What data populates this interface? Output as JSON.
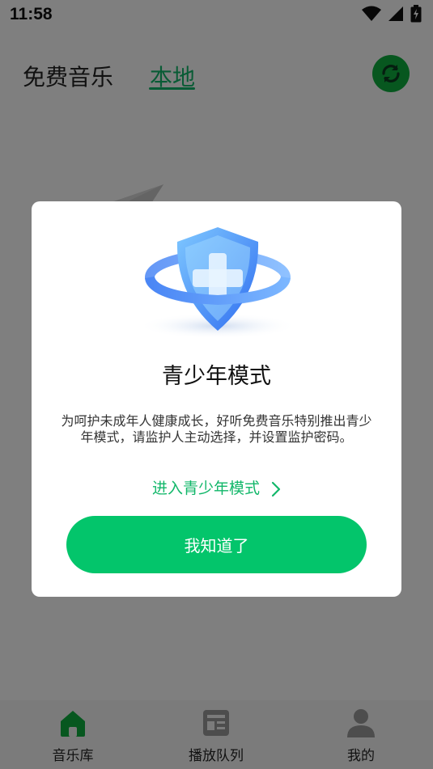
{
  "status_bar": {
    "time": "11:58",
    "icons": [
      "wifi-icon",
      "signal-icon",
      "battery-charging-icon"
    ]
  },
  "header": {
    "tabs": [
      {
        "label": "免费音乐",
        "active": false
      },
      {
        "label": "本地",
        "active": true
      }
    ],
    "refresh_icon": "refresh-icon"
  },
  "bottom_nav": {
    "items": [
      {
        "label": "音乐库",
        "icon": "home-icon",
        "active": true
      },
      {
        "label": "播放队列",
        "icon": "queue-icon",
        "active": false
      },
      {
        "label": "我的",
        "icon": "user-icon",
        "active": false
      }
    ]
  },
  "dialog": {
    "title": "青少年模式",
    "description": "为呵护未成年人健康成长，好听免费音乐特别推出青少年模式，请监护人主动选择，并设置监护密码。",
    "enter_link": "进入青少年模式",
    "confirm_button": "我知道了"
  },
  "colors": {
    "accent": "#03c56b",
    "link": "#12b76a",
    "refresh_bg": "#0fae3f"
  }
}
